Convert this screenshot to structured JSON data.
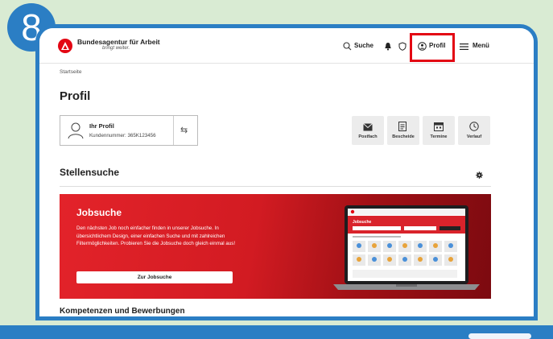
{
  "step_badge": "8",
  "header": {
    "brand_name": "Bundesagentur für Arbeit",
    "brand_tagline": "bringt weiter.",
    "search_label": "Suche",
    "profil_label": "Profil",
    "menu_label": "Menü",
    "highlight_color": "#e30613"
  },
  "breadcrumb": "Startseite",
  "page_title": "Profil",
  "profile_card": {
    "title": "Ihr Profil",
    "customer_number": "Kundennummer: 365K123456"
  },
  "quick_links": [
    {
      "label": "Postfach",
      "icon": "mail-icon"
    },
    {
      "label": "Bescheide",
      "icon": "document-icon"
    },
    {
      "label": "Termine",
      "icon": "calendar-icon"
    },
    {
      "label": "Verlauf",
      "icon": "clock-icon"
    }
  ],
  "stellensuche": {
    "title": "Stellensuche",
    "banner": {
      "title": "Jobsuche",
      "text": "Den nächsten Job noch einfacher finden in unserer Jobsuche. In übersichtlichem Design, einer einfachen Suche und mit zahlreichen Filtermöglichkeiten. Probieren Sie die Jobsuche doch gleich einmal aus!",
      "button_label": "Zur Jobsuche",
      "preview_title": "Jobsuche"
    }
  },
  "next_section_title": "Kompetenzen und Bewerbungen",
  "colors": {
    "frame_blue": "#2b7ec4",
    "brand_red": "#e30613",
    "background_green": "#d9ebd3"
  }
}
